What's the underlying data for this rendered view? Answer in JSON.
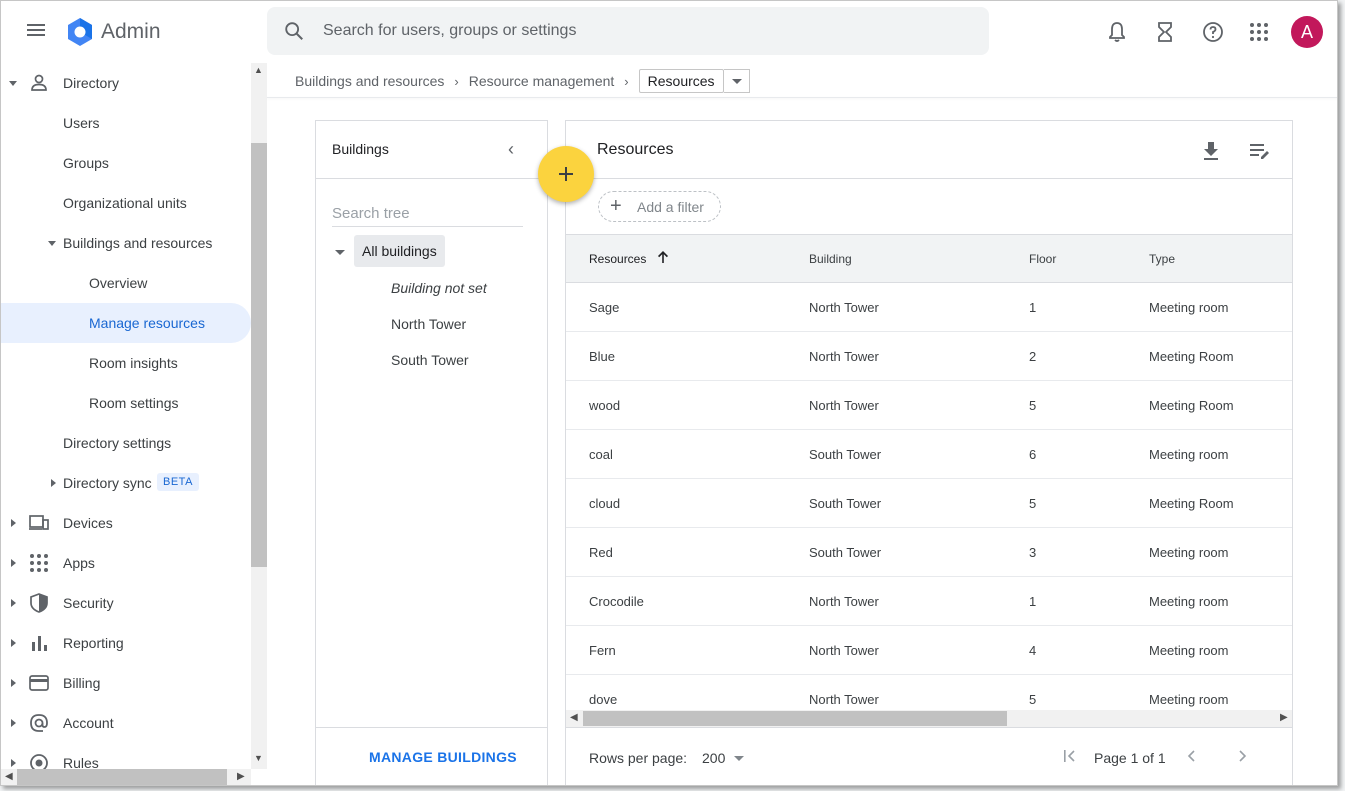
{
  "app": {
    "title": "Admin"
  },
  "search": {
    "placeholder": "Search for users, groups or settings"
  },
  "topbar": {
    "avatar_letter": "A",
    "avatar_color": "#c2185b"
  },
  "sidebar": {
    "items": [
      {
        "label": "Directory"
      },
      {
        "label": "Users"
      },
      {
        "label": "Groups"
      },
      {
        "label": "Organizational units"
      },
      {
        "label": "Buildings and resources"
      },
      {
        "label": "Overview"
      },
      {
        "label": "Manage resources"
      },
      {
        "label": "Room insights"
      },
      {
        "label": "Room settings"
      },
      {
        "label": "Directory settings"
      },
      {
        "label": "Directory sync",
        "badge": "BETA"
      },
      {
        "label": "Devices"
      },
      {
        "label": "Apps"
      },
      {
        "label": "Security"
      },
      {
        "label": "Reporting"
      },
      {
        "label": "Billing"
      },
      {
        "label": "Account"
      },
      {
        "label": "Rules"
      }
    ]
  },
  "breadcrumb": {
    "items": [
      "Buildings and resources",
      "Resource management"
    ],
    "current": "Resources"
  },
  "buildings_panel": {
    "title": "Buildings",
    "search_placeholder": "Search tree",
    "root": "All buildings",
    "items": [
      "Building not set",
      "North Tower",
      "South Tower"
    ],
    "manage_button": "MANAGE BUILDINGS"
  },
  "resources_panel": {
    "title": "Resources",
    "add_filter": "Add a filter",
    "columns": [
      "Resources",
      "Building",
      "Floor",
      "Type"
    ],
    "rows": [
      [
        "Sage",
        "North Tower",
        "1",
        "Meeting room"
      ],
      [
        "Blue",
        "North Tower",
        "2",
        "Meeting Room"
      ],
      [
        "wood",
        "North Tower",
        "5",
        "Meeting Room"
      ],
      [
        "coal",
        "South Tower",
        "6",
        "Meeting room"
      ],
      [
        "cloud",
        "South Tower",
        "5",
        "Meeting Room"
      ],
      [
        "Red",
        "South Tower",
        "3",
        "Meeting room"
      ],
      [
        "Crocodile",
        "North Tower",
        "1",
        "Meeting room"
      ],
      [
        "Fern",
        "North Tower",
        "4",
        "Meeting room"
      ],
      [
        "dove",
        "North Tower",
        "5",
        "Meeting room"
      ]
    ],
    "rows_per_page_label": "Rows per page:",
    "rows_per_page_value": "200",
    "page_label": "Page 1 of 1"
  },
  "colors": {
    "accent": "#1a73e8",
    "fab": "#fbd33e",
    "active_bg": "#e8f0fe"
  }
}
